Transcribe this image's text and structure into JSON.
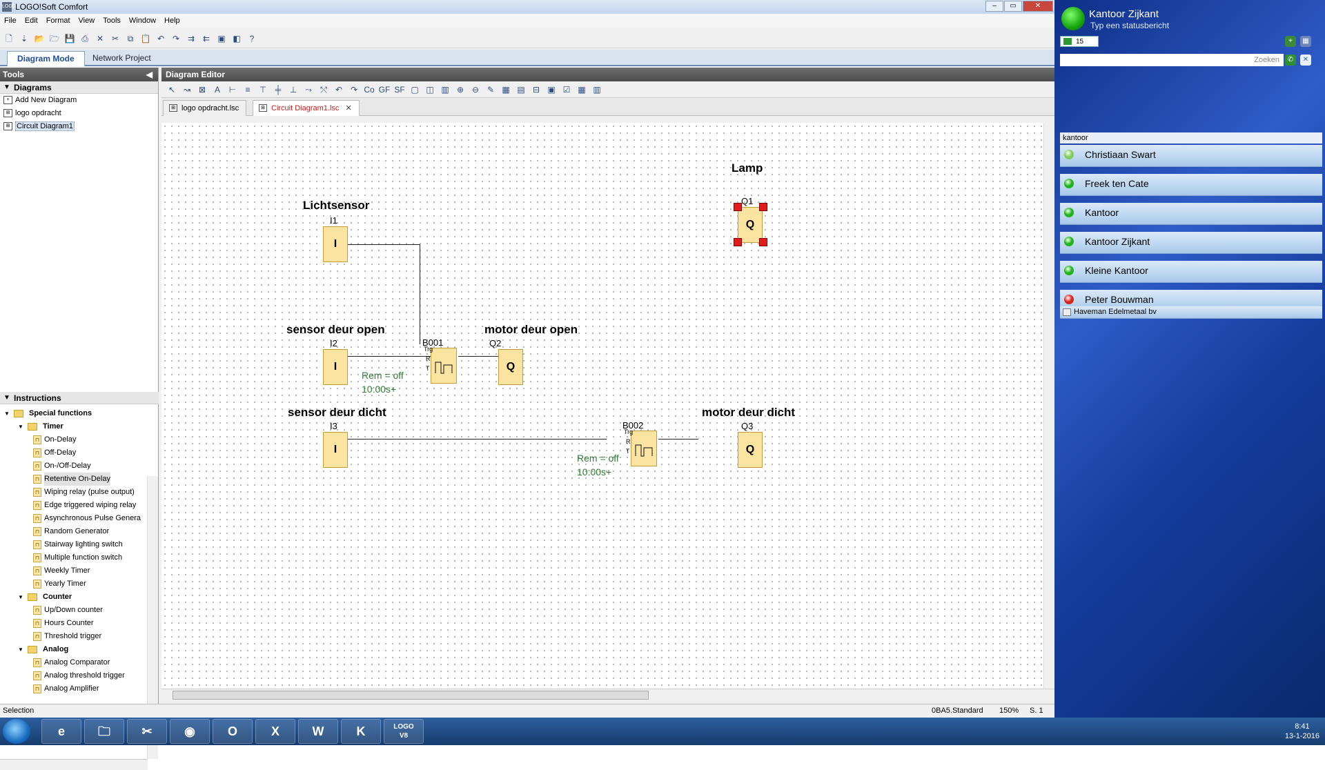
{
  "window": {
    "title": "LOGO!Soft Comfort",
    "app_icon": "LOGO"
  },
  "menu": [
    "File",
    "Edit",
    "Format",
    "View",
    "Tools",
    "Window",
    "Help"
  ],
  "mode_tabs": [
    "Diagram Mode",
    "Network Project"
  ],
  "tools_panel": {
    "header": "Tools",
    "diagrams_header": "Diagrams",
    "diagrams": [
      "Add New Diagram",
      "logo opdracht",
      "Circuit Diagram1"
    ],
    "instructions_header": "Instructions"
  },
  "tree": {
    "special_functions": "Special functions",
    "timer": "Timer",
    "timer_items": [
      "On-Delay",
      "Off-Delay",
      "On-/Off-Delay",
      "Retentive On-Delay",
      "Wiping relay (pulse output)",
      "Edge triggered wiping relay",
      "Asynchronous Pulse Genera",
      "Random Generator",
      "Stairway lighting switch",
      "Multiple function switch",
      "Weekly Timer",
      "Yearly Timer"
    ],
    "counter": "Counter",
    "counter_items": [
      "Up/Down counter",
      "Hours Counter",
      "Threshold trigger"
    ],
    "analog": "Analog",
    "analog_items": [
      "Analog Comparator",
      "Analog threshold trigger",
      "Analog Amplifier"
    ]
  },
  "editor": {
    "header": "Diagram Editor",
    "file_tabs": [
      "logo opdracht.lsc",
      "Circuit Diagram1.lsc"
    ]
  },
  "diagram": {
    "titles": {
      "lamp": "Lamp",
      "lichtsensor": "Lichtsensor",
      "sensor_open": "sensor deur open",
      "motor_open": "motor deur open",
      "sensor_dicht": "sensor deur dicht",
      "motor_dicht": "motor deur dicht"
    },
    "blocks": {
      "i1": {
        "label": "I1",
        "symbol": "I"
      },
      "i2": {
        "label": "I2",
        "symbol": "I"
      },
      "i3": {
        "label": "I3",
        "symbol": "I"
      },
      "q1": {
        "label": "Q1",
        "symbol": "Q"
      },
      "q2": {
        "label": "Q2",
        "symbol": "Q"
      },
      "q3": {
        "label": "Q3",
        "symbol": "Q"
      },
      "b001": {
        "label": "B001"
      },
      "b002": {
        "label": "B002"
      }
    },
    "pins": {
      "trg": "Trg",
      "r": "R",
      "t": "T"
    },
    "params": {
      "b001_rem": "Rem = off",
      "b001_time": "10:00s+",
      "b002_rem": "Rem = off",
      "b002_time": "10:00s+"
    }
  },
  "statusbar": {
    "left": "Selection",
    "device": "0BA5.Standard",
    "zoom": "150%",
    "page": "S. 1"
  },
  "im_client": {
    "user_name": "Kantoor Zijkant",
    "status_message": "Typ een statusbericht",
    "mail_count": "15",
    "search_placeholder": "Zoeken",
    "group": "kantoor",
    "contacts": [
      {
        "name": "Christiaan Swart",
        "status": "online-idle",
        "color": "#7ccf5a"
      },
      {
        "name": "Freek ten Cate",
        "status": "online",
        "color": "#1fb51a"
      },
      {
        "name": "Kantoor",
        "status": "online",
        "color": "#1fb51a"
      },
      {
        "name": "Kantoor Zijkant",
        "status": "online",
        "color": "#1fb51a"
      },
      {
        "name": "Kleine Kantoor",
        "status": "online",
        "color": "#1fb51a"
      },
      {
        "name": "Peter Bouwman",
        "status": "busy",
        "color": "#d9261c"
      }
    ],
    "company": "Haveman Edelmetaal bv"
  },
  "taskbar": {
    "items": [
      "start-button",
      "ie-icon",
      "explorer-icon",
      "snipping-icon",
      "chrome-icon",
      "outlook-icon",
      "excel-icon",
      "word-icon",
      "k-icon",
      "logo-v8-icon"
    ],
    "logo_label_top": "LOGO",
    "logo_label_bottom": "V8",
    "time": "8:41",
    "date": "13-1-2016"
  }
}
